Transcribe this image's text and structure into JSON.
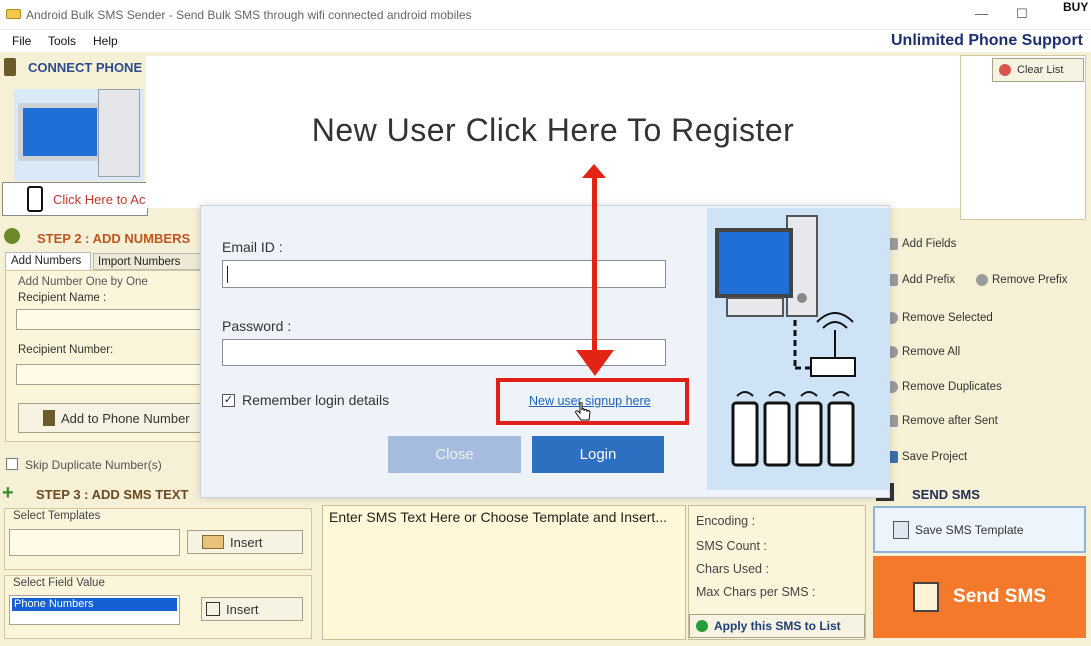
{
  "window": {
    "title": "Android Bulk SMS Sender - Send Bulk SMS through wifi connected android mobiles",
    "buy": "BUY",
    "minimize_glyph": "—",
    "maximize_glyph": "☐"
  },
  "menu": {
    "file": "File",
    "tools": "Tools",
    "help": "Help",
    "support": "Unlimited Phone Support"
  },
  "connect": {
    "header": "CONNECT PHONE",
    "click_label": "Click Here to Ac"
  },
  "recipients": {
    "clear_list": "Clear List"
  },
  "step2": {
    "header": "STEP 2 : ADD NUMBERS",
    "tab_add": "Add Numbers",
    "tab_import": "Import Numbers",
    "group": "Add Number One by One",
    "name_label": "Recipient Name :",
    "number_label": "Recipient Number:",
    "add_button": "Add to Phone Number",
    "skip_dupes": "Skip Duplicate Number(s)"
  },
  "step3": {
    "header": "STEP 3 : ADD SMS TEXT",
    "templates_label": "Select Templates",
    "insert": "Insert",
    "field_label": "Select Field Value",
    "field_selected": "Phone Numbers",
    "insert2": "Insert"
  },
  "sms": {
    "text": "Enter SMS Text Here or Choose Template and Insert...",
    "encoding": "Encoding :",
    "count": "SMS Count :",
    "chars_used": "Chars Used :",
    "max_chars": "Max Chars per SMS :",
    "apply": "Apply this SMS to List"
  },
  "right_buttons": {
    "add_fields": "Add Fields",
    "add_prefix": "Add Prefix",
    "remove_prefix": "Remove Prefix",
    "remove_selected": "Remove Selected",
    "remove_all": "Remove All",
    "remove_duplicates": "Remove Duplicates",
    "remove_after_sent": "Remove after Sent",
    "save_project": "Save Project"
  },
  "send": {
    "header": "SEND SMS",
    "save_template": "Save SMS Template",
    "send_button": "Send SMS"
  },
  "dialog": {
    "email_label": "Email ID :",
    "email_value": "",
    "password_label": "Password :",
    "password_value": "",
    "remember": "Remember login details",
    "signup_link": "New user signup here",
    "close": "Close",
    "login": "Login"
  },
  "overlay": {
    "register_text": "New User Click Here To Register"
  },
  "colors": {
    "accent_red": "#e32415",
    "login_blue": "#2d6fc0",
    "send_orange": "#f4792b"
  }
}
